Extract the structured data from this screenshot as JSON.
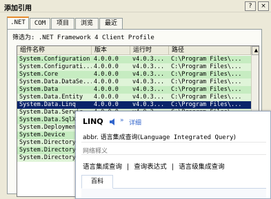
{
  "window": {
    "title": "添加引用",
    "help": "?",
    "close": "×"
  },
  "tabs": [
    ".NET",
    "COM",
    "项目",
    "浏览",
    "最近"
  ],
  "filter_text": "筛选为: .NET Framework 4 Client Profile",
  "columns": [
    "组件名称",
    "版本",
    "运行时",
    "路径"
  ],
  "rows": [
    {
      "name": "System.Configuration",
      "version": "4.0.0.0",
      "runtime": "v4.0.3...",
      "path": "C:\\Program Files\\..."
    },
    {
      "name": "System.Configurati...",
      "version": "4.0.0.0",
      "runtime": "v4.0.3...",
      "path": "C:\\Program Files\\..."
    },
    {
      "name": "System.Core",
      "version": "4.0.0.0",
      "runtime": "v4.0.3...",
      "path": "C:\\Program Files\\..."
    },
    {
      "name": "System.Data.DataSe...",
      "version": "4.0.0.0",
      "runtime": "v4.0.3...",
      "path": "C:\\Program Files\\..."
    },
    {
      "name": "System.Data",
      "version": "4.0.0.0",
      "runtime": "v4.0.3...",
      "path": "C:\\Program Files\\..."
    },
    {
      "name": "System.Data.Entity",
      "version": "4.0.0.0",
      "runtime": "v4.0.3...",
      "path": "C:\\Program Files\\..."
    },
    {
      "name": "System.Data.Linq",
      "version": "4.0.0.0",
      "runtime": "v4.0.3...",
      "path": "C:\\Program Files\\..."
    },
    {
      "name": "System.Data.Servic...",
      "version": "4.0.0.0",
      "runtime": "v4.0.3...",
      "path": "C:\\Program Files\\..."
    },
    {
      "name": "System.Data.SqlXm",
      "version": "",
      "runtime": "",
      "path": ""
    },
    {
      "name": "System.Deployment",
      "version": "",
      "runtime": "",
      "path": ""
    },
    {
      "name": "System.Device",
      "version": "",
      "runtime": "",
      "path": ""
    },
    {
      "name": "System.Directory",
      "version": "",
      "runtime": "",
      "path": ""
    },
    {
      "name": "System.Directory",
      "version": "",
      "runtime": "",
      "path": ""
    },
    {
      "name": "System.Directory",
      "version": "",
      "runtime": "",
      "path": ""
    }
  ],
  "selected_row": "System.Data.Linq",
  "popup": {
    "word": "LINQ",
    "speaker_icon": "speaker-icon",
    "arrow": "»",
    "detail": "详细",
    "abbr_label": "abbr.",
    "definition_cn": "语言集成查询(",
    "definition_en": "Language Integrated Query",
    "definition_end": ")",
    "section_title": "网络释义",
    "translations": [
      "语言集成查询",
      "|",
      "查询表达式",
      "|",
      "语言级集成查询"
    ],
    "tab": "百科"
  },
  "colors": {
    "row_green": "#c6ecc1",
    "row_green_light": "#dff4d8",
    "selected": "#0a246a",
    "link": "#3366cc"
  }
}
